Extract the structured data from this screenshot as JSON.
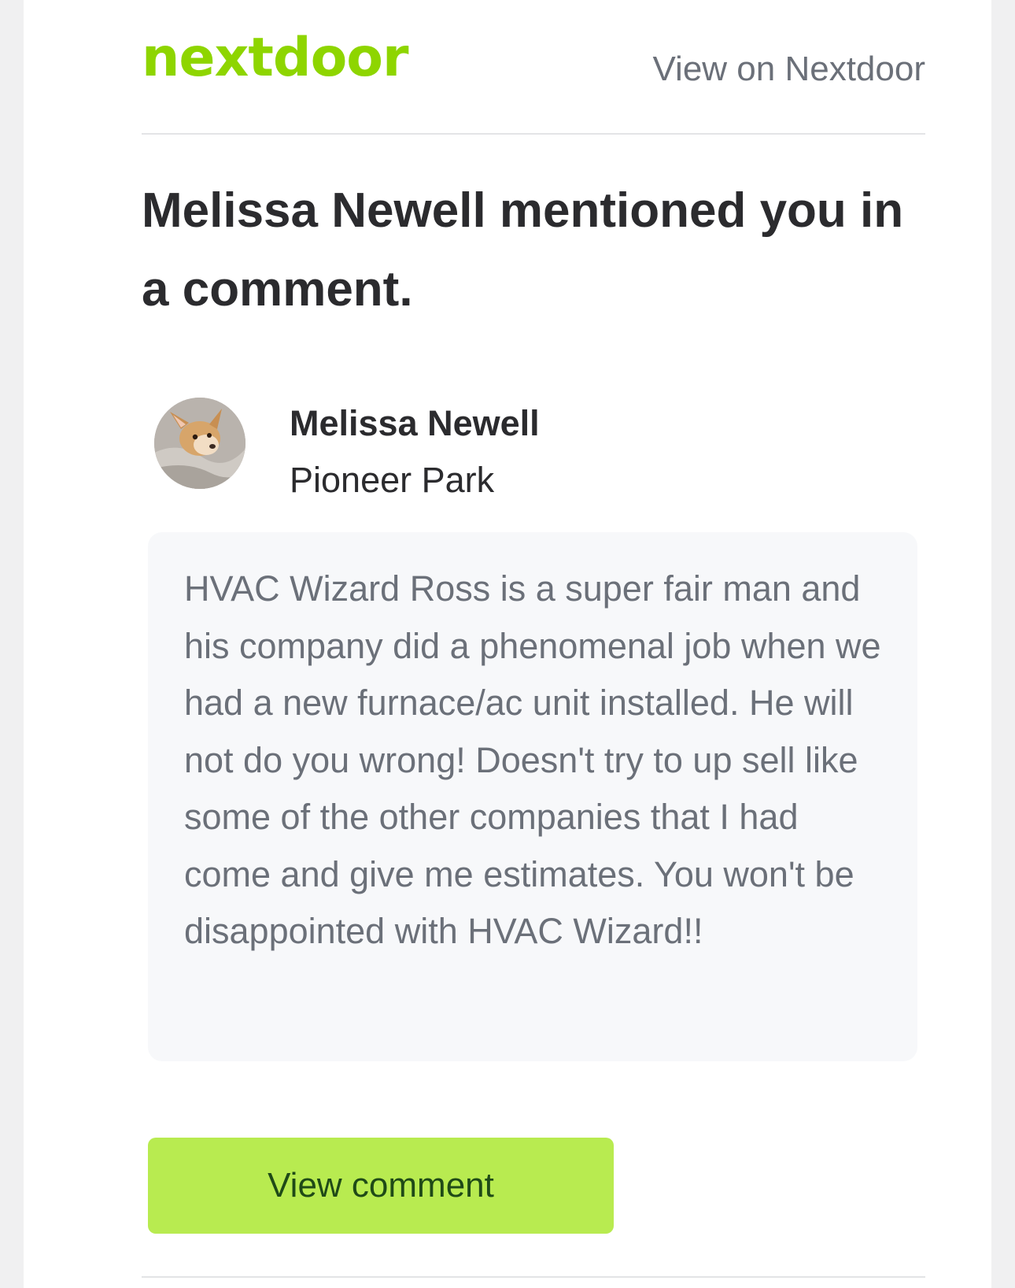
{
  "header": {
    "logo_text": "nextdoor",
    "view_on_label": "View on Nextdoor"
  },
  "headline": "Melissa Newell mentioned you in a comment.",
  "author": {
    "name": "Melissa Newell",
    "neighborhood": "Pioneer Park",
    "avatar_icon": "dog-photo-avatar"
  },
  "comment": {
    "text": "HVAC Wizard Ross is a super fair man and his company did a phenomenal job when we had a new furnace/ac unit installed. He will not do you wrong! Doesn't try to up sell like some of the other companies that I had come and give me estimates. You won't be disappointed with HVAC Wizard!!"
  },
  "cta": {
    "label": "View comment"
  },
  "colors": {
    "brand_green": "#8ed500",
    "button_green": "#b8eb50",
    "button_text": "#1f4a17",
    "comment_bg": "#f7f8fa"
  }
}
